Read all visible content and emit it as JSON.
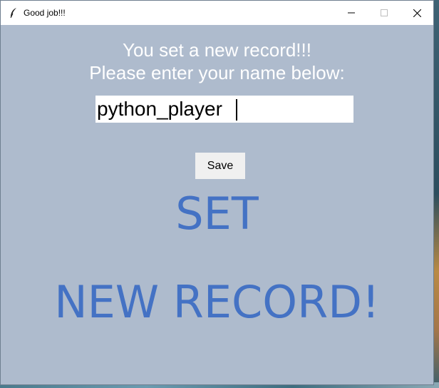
{
  "window": {
    "title": "Good job!!!",
    "icon": "feather-icon"
  },
  "message": {
    "line1": "You set a new record!!!",
    "line2": "Please enter your name below:"
  },
  "name_input": {
    "value": "python_player"
  },
  "save_button": {
    "label": "Save"
  },
  "banner": {
    "line1": "SET",
    "line2": "NEW RECORD!"
  },
  "colors": {
    "background": "#aebbcd",
    "banner_text": "#4472c4",
    "message_text": "#ffffff"
  }
}
